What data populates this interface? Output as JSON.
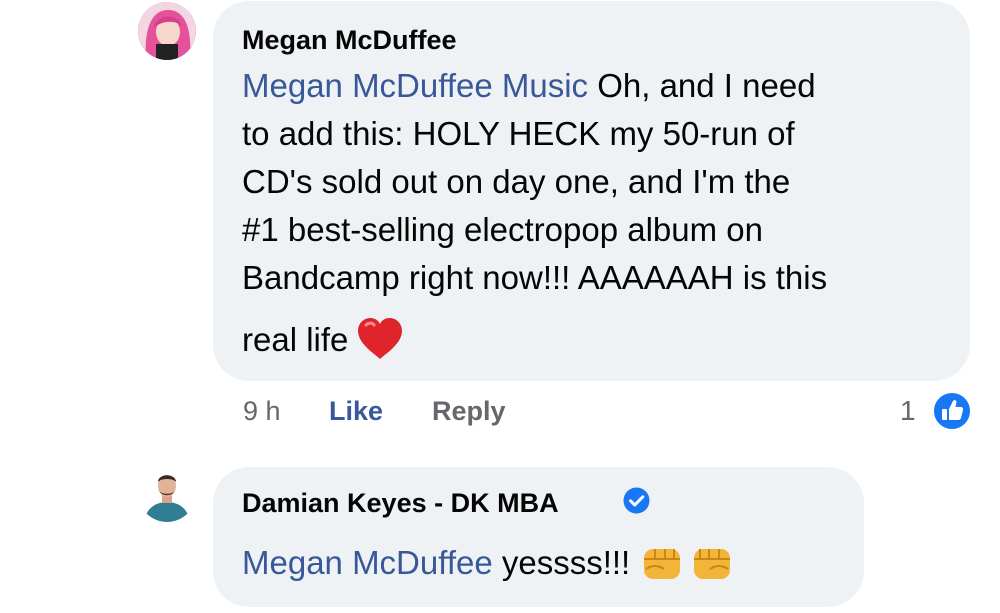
{
  "comments": [
    {
      "author": "Megan McDuffee",
      "mention": "Megan McDuffee Music",
      "lines": [
        " Oh, and I need",
        "to add this: HOLY HECK my 50-run of",
        "CD's sold out on day one, and I'm the",
        "#1 best-selling electropop album on",
        "Bandcamp right now!!! AAAAAAH is this",
        "real life"
      ],
      "emoji": "red-heart",
      "time": "9 h",
      "like_label": "Like",
      "reply_label": "Reply",
      "reaction_count": "1"
    },
    {
      "author": "Damian Keyes - DK MBA",
      "verified": true,
      "mention": "Megan McDuffee",
      "text": " yessss!!!",
      "emoji": "oncoming-fist x2"
    }
  ],
  "colors": {
    "bubble": "#eff2f5",
    "link": "#385898",
    "secondary_text": "#65676b",
    "like_badge": "#1877f2",
    "heart": "#e0242c",
    "fist": "#f4b43a"
  }
}
